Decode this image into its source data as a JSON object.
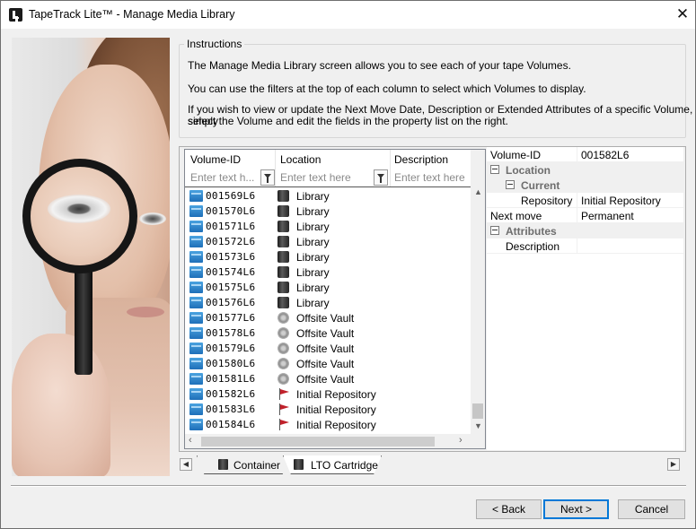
{
  "window": {
    "title": "TapeTrack Lite™ - Manage Media Library",
    "close_glyph": "✕"
  },
  "instructions": {
    "legend": "Instructions",
    "lines": [
      "The Manage Media Library screen allows you to see each of your tape Volumes.",
      "You can use the filters at the top of each column to select which Volumes to display.",
      "If you wish to view or update the Next Move Date, Description or Extended Attributes of a specific Volume, simply",
      "select the Volume and edit the fields in the property list on the right."
    ]
  },
  "grid": {
    "columns": [
      "Volume-ID",
      "Location",
      "Description"
    ],
    "filter_placeholders": [
      "Enter text h...",
      "Enter text here",
      "Enter text here"
    ],
    "rows": [
      {
        "volume_id": "001569L6",
        "location": "Library",
        "icon": "library-icon"
      },
      {
        "volume_id": "001570L6",
        "location": "Library",
        "icon": "library-icon"
      },
      {
        "volume_id": "001571L6",
        "location": "Library",
        "icon": "library-icon"
      },
      {
        "volume_id": "001572L6",
        "location": "Library",
        "icon": "library-icon"
      },
      {
        "volume_id": "001573L6",
        "location": "Library",
        "icon": "library-icon"
      },
      {
        "volume_id": "001574L6",
        "location": "Library",
        "icon": "library-icon"
      },
      {
        "volume_id": "001575L6",
        "location": "Library",
        "icon": "library-icon"
      },
      {
        "volume_id": "001576L6",
        "location": "Library",
        "icon": "library-icon"
      },
      {
        "volume_id": "001577L6",
        "location": "Offsite Vault",
        "icon": "vault-icon"
      },
      {
        "volume_id": "001578L6",
        "location": "Offsite Vault",
        "icon": "vault-icon"
      },
      {
        "volume_id": "001579L6",
        "location": "Offsite Vault",
        "icon": "vault-icon"
      },
      {
        "volume_id": "001580L6",
        "location": "Offsite Vault",
        "icon": "vault-icon"
      },
      {
        "volume_id": "001581L6",
        "location": "Offsite Vault",
        "icon": "vault-icon"
      },
      {
        "volume_id": "001582L6",
        "location": "Initial Repository",
        "icon": "flag-icon"
      },
      {
        "volume_id": "001583L6",
        "location": "Initial Repository",
        "icon": "flag-icon"
      },
      {
        "volume_id": "001584L6",
        "location": "Initial Repository",
        "icon": "flag-icon"
      }
    ]
  },
  "properties": {
    "volume_id_label": "Volume-ID",
    "volume_id_value": "001582L6",
    "location_category": "Location",
    "current_category": "Current",
    "repository_label": "Repository",
    "repository_value": "Initial Repository",
    "next_move_label": "Next move",
    "next_move_value": "Permanent",
    "attributes_category": "Attributes",
    "description_label": "Description",
    "description_value": ""
  },
  "tabs": [
    {
      "label": "Container"
    },
    {
      "label": "LTO Cartridge"
    }
  ],
  "buttons": {
    "back": "< Back",
    "next": "Next >",
    "cancel": "Cancel"
  },
  "colors": {
    "accent": "#0078d7",
    "flag_red": "#c0202a",
    "volume_blue": "#1e6fb8"
  }
}
